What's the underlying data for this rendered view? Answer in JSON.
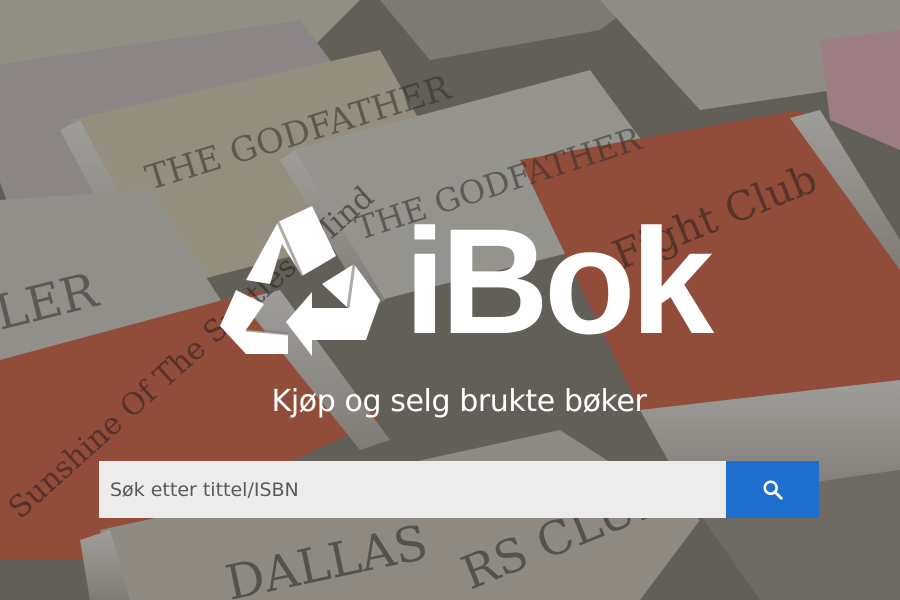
{
  "brand": {
    "name": "iBok",
    "logo_icon": "recycle-icon"
  },
  "hero": {
    "tagline": "Kjøp og selg brukte bøker"
  },
  "search": {
    "placeholder": "Søk etter tittel/ISBN",
    "value": "",
    "button_icon": "search-icon",
    "button_color": "#1e6fd0"
  },
  "background": {
    "description_icon": "book-stack-photo",
    "book_titles": [
      "The Godfather",
      "The Godfather Pt.III",
      "Fight Club",
      "Eternal Sunshine Of The Spotless Mind",
      "Dallas Buyers Club"
    ]
  }
}
